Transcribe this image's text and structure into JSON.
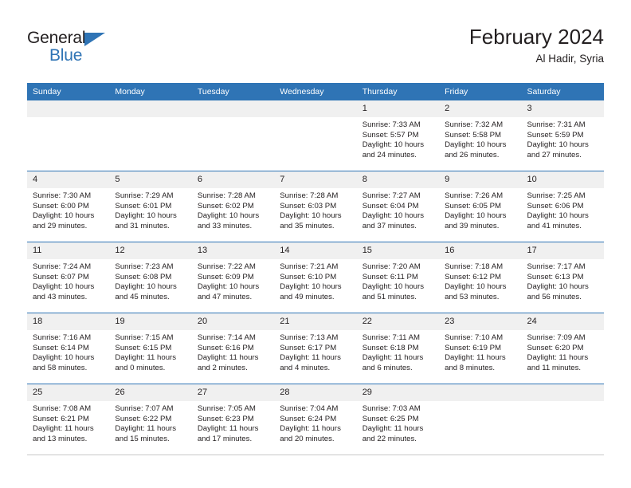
{
  "brand": {
    "name_line1": "General",
    "name_line2": "Blue",
    "accent_color": "#2f74b5"
  },
  "header": {
    "title": "February 2024",
    "subtitle": "Al Hadir, Syria"
  },
  "calendar": {
    "weekday_headers": [
      "Sunday",
      "Monday",
      "Tuesday",
      "Wednesday",
      "Thursday",
      "Friday",
      "Saturday"
    ],
    "header_bg": "#2f74b5",
    "daynum_bg": "#f0f0f0",
    "weeks": [
      [
        {
          "day": "",
          "sunrise": "",
          "sunset": "",
          "daylight_line1": "",
          "daylight_line2": ""
        },
        {
          "day": "",
          "sunrise": "",
          "sunset": "",
          "daylight_line1": "",
          "daylight_line2": ""
        },
        {
          "day": "",
          "sunrise": "",
          "sunset": "",
          "daylight_line1": "",
          "daylight_line2": ""
        },
        {
          "day": "",
          "sunrise": "",
          "sunset": "",
          "daylight_line1": "",
          "daylight_line2": ""
        },
        {
          "day": "1",
          "sunrise": "Sunrise: 7:33 AM",
          "sunset": "Sunset: 5:57 PM",
          "daylight_line1": "Daylight: 10 hours",
          "daylight_line2": "and 24 minutes."
        },
        {
          "day": "2",
          "sunrise": "Sunrise: 7:32 AM",
          "sunset": "Sunset: 5:58 PM",
          "daylight_line1": "Daylight: 10 hours",
          "daylight_line2": "and 26 minutes."
        },
        {
          "day": "3",
          "sunrise": "Sunrise: 7:31 AM",
          "sunset": "Sunset: 5:59 PM",
          "daylight_line1": "Daylight: 10 hours",
          "daylight_line2": "and 27 minutes."
        }
      ],
      [
        {
          "day": "4",
          "sunrise": "Sunrise: 7:30 AM",
          "sunset": "Sunset: 6:00 PM",
          "daylight_line1": "Daylight: 10 hours",
          "daylight_line2": "and 29 minutes."
        },
        {
          "day": "5",
          "sunrise": "Sunrise: 7:29 AM",
          "sunset": "Sunset: 6:01 PM",
          "daylight_line1": "Daylight: 10 hours",
          "daylight_line2": "and 31 minutes."
        },
        {
          "day": "6",
          "sunrise": "Sunrise: 7:28 AM",
          "sunset": "Sunset: 6:02 PM",
          "daylight_line1": "Daylight: 10 hours",
          "daylight_line2": "and 33 minutes."
        },
        {
          "day": "7",
          "sunrise": "Sunrise: 7:28 AM",
          "sunset": "Sunset: 6:03 PM",
          "daylight_line1": "Daylight: 10 hours",
          "daylight_line2": "and 35 minutes."
        },
        {
          "day": "8",
          "sunrise": "Sunrise: 7:27 AM",
          "sunset": "Sunset: 6:04 PM",
          "daylight_line1": "Daylight: 10 hours",
          "daylight_line2": "and 37 minutes."
        },
        {
          "day": "9",
          "sunrise": "Sunrise: 7:26 AM",
          "sunset": "Sunset: 6:05 PM",
          "daylight_line1": "Daylight: 10 hours",
          "daylight_line2": "and 39 minutes."
        },
        {
          "day": "10",
          "sunrise": "Sunrise: 7:25 AM",
          "sunset": "Sunset: 6:06 PM",
          "daylight_line1": "Daylight: 10 hours",
          "daylight_line2": "and 41 minutes."
        }
      ],
      [
        {
          "day": "11",
          "sunrise": "Sunrise: 7:24 AM",
          "sunset": "Sunset: 6:07 PM",
          "daylight_line1": "Daylight: 10 hours",
          "daylight_line2": "and 43 minutes."
        },
        {
          "day": "12",
          "sunrise": "Sunrise: 7:23 AM",
          "sunset": "Sunset: 6:08 PM",
          "daylight_line1": "Daylight: 10 hours",
          "daylight_line2": "and 45 minutes."
        },
        {
          "day": "13",
          "sunrise": "Sunrise: 7:22 AM",
          "sunset": "Sunset: 6:09 PM",
          "daylight_line1": "Daylight: 10 hours",
          "daylight_line2": "and 47 minutes."
        },
        {
          "day": "14",
          "sunrise": "Sunrise: 7:21 AM",
          "sunset": "Sunset: 6:10 PM",
          "daylight_line1": "Daylight: 10 hours",
          "daylight_line2": "and 49 minutes."
        },
        {
          "day": "15",
          "sunrise": "Sunrise: 7:20 AM",
          "sunset": "Sunset: 6:11 PM",
          "daylight_line1": "Daylight: 10 hours",
          "daylight_line2": "and 51 minutes."
        },
        {
          "day": "16",
          "sunrise": "Sunrise: 7:18 AM",
          "sunset": "Sunset: 6:12 PM",
          "daylight_line1": "Daylight: 10 hours",
          "daylight_line2": "and 53 minutes."
        },
        {
          "day": "17",
          "sunrise": "Sunrise: 7:17 AM",
          "sunset": "Sunset: 6:13 PM",
          "daylight_line1": "Daylight: 10 hours",
          "daylight_line2": "and 56 minutes."
        }
      ],
      [
        {
          "day": "18",
          "sunrise": "Sunrise: 7:16 AM",
          "sunset": "Sunset: 6:14 PM",
          "daylight_line1": "Daylight: 10 hours",
          "daylight_line2": "and 58 minutes."
        },
        {
          "day": "19",
          "sunrise": "Sunrise: 7:15 AM",
          "sunset": "Sunset: 6:15 PM",
          "daylight_line1": "Daylight: 11 hours",
          "daylight_line2": "and 0 minutes."
        },
        {
          "day": "20",
          "sunrise": "Sunrise: 7:14 AM",
          "sunset": "Sunset: 6:16 PM",
          "daylight_line1": "Daylight: 11 hours",
          "daylight_line2": "and 2 minutes."
        },
        {
          "day": "21",
          "sunrise": "Sunrise: 7:13 AM",
          "sunset": "Sunset: 6:17 PM",
          "daylight_line1": "Daylight: 11 hours",
          "daylight_line2": "and 4 minutes."
        },
        {
          "day": "22",
          "sunrise": "Sunrise: 7:11 AM",
          "sunset": "Sunset: 6:18 PM",
          "daylight_line1": "Daylight: 11 hours",
          "daylight_line2": "and 6 minutes."
        },
        {
          "day": "23",
          "sunrise": "Sunrise: 7:10 AM",
          "sunset": "Sunset: 6:19 PM",
          "daylight_line1": "Daylight: 11 hours",
          "daylight_line2": "and 8 minutes."
        },
        {
          "day": "24",
          "sunrise": "Sunrise: 7:09 AM",
          "sunset": "Sunset: 6:20 PM",
          "daylight_line1": "Daylight: 11 hours",
          "daylight_line2": "and 11 minutes."
        }
      ],
      [
        {
          "day": "25",
          "sunrise": "Sunrise: 7:08 AM",
          "sunset": "Sunset: 6:21 PM",
          "daylight_line1": "Daylight: 11 hours",
          "daylight_line2": "and 13 minutes."
        },
        {
          "day": "26",
          "sunrise": "Sunrise: 7:07 AM",
          "sunset": "Sunset: 6:22 PM",
          "daylight_line1": "Daylight: 11 hours",
          "daylight_line2": "and 15 minutes."
        },
        {
          "day": "27",
          "sunrise": "Sunrise: 7:05 AM",
          "sunset": "Sunset: 6:23 PM",
          "daylight_line1": "Daylight: 11 hours",
          "daylight_line2": "and 17 minutes."
        },
        {
          "day": "28",
          "sunrise": "Sunrise: 7:04 AM",
          "sunset": "Sunset: 6:24 PM",
          "daylight_line1": "Daylight: 11 hours",
          "daylight_line2": "and 20 minutes."
        },
        {
          "day": "29",
          "sunrise": "Sunrise: 7:03 AM",
          "sunset": "Sunset: 6:25 PM",
          "daylight_line1": "Daylight: 11 hours",
          "daylight_line2": "and 22 minutes."
        },
        {
          "day": "",
          "sunrise": "",
          "sunset": "",
          "daylight_line1": "",
          "daylight_line2": ""
        },
        {
          "day": "",
          "sunrise": "",
          "sunset": "",
          "daylight_line1": "",
          "daylight_line2": ""
        }
      ]
    ]
  }
}
